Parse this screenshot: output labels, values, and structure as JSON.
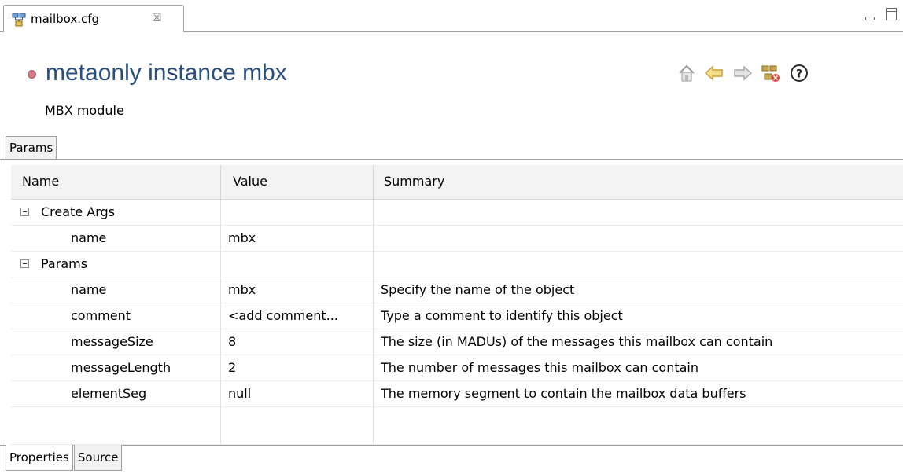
{
  "editor_tab": {
    "label": "mailbox.cfg",
    "close_glyph": "☒",
    "icon": "config-file-icon"
  },
  "window_controls": {
    "minimize_icon": "minimize-icon",
    "maximize_icon": "maximize-icon"
  },
  "header": {
    "title": "metaonly instance mbx",
    "subtitle": "MBX module",
    "status_dot_color": "#d07a85",
    "title_color": "#2b4f7c",
    "nav_icons": [
      "home-icon",
      "back-arrow-icon",
      "forward-arrow-icon",
      "remove-config-icon",
      "help-icon"
    ]
  },
  "section_tab": {
    "label": "Params"
  },
  "table": {
    "columns": [
      "Name",
      "Value",
      "Summary"
    ],
    "rows": [
      {
        "name": "Create Args",
        "value": "",
        "summary": "",
        "group": true
      },
      {
        "name": "name",
        "value": "mbx",
        "summary": "",
        "group": false
      },
      {
        "name": "Params",
        "value": "",
        "summary": "",
        "group": true
      },
      {
        "name": "name",
        "value": "mbx",
        "summary": "Specify the name of the object",
        "group": false
      },
      {
        "name": "comment",
        "value": "<add comment...",
        "summary": "Type a comment to identify this object",
        "group": false
      },
      {
        "name": "messageSize",
        "value": "8",
        "summary": "The size (in MADUs) of the messages this mailbox can contain",
        "group": false
      },
      {
        "name": "messageLength",
        "value": "2",
        "summary": "The number of messages this mailbox can contain",
        "group": false
      },
      {
        "name": "elementSeg",
        "value": "null",
        "summary": "The memory segment to contain the mailbox data buffers",
        "group": false
      },
      {
        "name": "",
        "value": "",
        "summary": "",
        "group": false
      }
    ]
  },
  "bottom_tabs": [
    {
      "label": "Properties",
      "active": true
    },
    {
      "label": "Source",
      "active": false
    }
  ]
}
